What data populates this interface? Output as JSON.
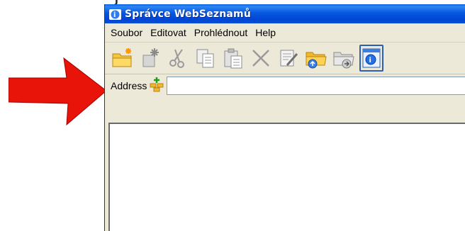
{
  "window": {
    "title": "Správce WebSeznamů",
    "accent_color": "#0a58dc",
    "title_icon": "app-globe-icon"
  },
  "menu": {
    "items": [
      {
        "label": "Soubor"
      },
      {
        "label": "Editovat"
      },
      {
        "label": "Prohlédnout"
      },
      {
        "label": "Help"
      }
    ]
  },
  "toolbar": {
    "buttons": [
      {
        "icon": "new-folder-icon"
      },
      {
        "icon": "new-item-icon"
      },
      {
        "icon": "cut-icon"
      },
      {
        "icon": "copy-icon"
      },
      {
        "icon": "paste-icon"
      },
      {
        "icon": "delete-icon"
      },
      {
        "icon": "properties-icon"
      },
      {
        "icon": "open-folder-icon"
      },
      {
        "icon": "export-folder-icon"
      },
      {
        "icon": "browser-window-icon"
      }
    ]
  },
  "address": {
    "label": "Address",
    "value": "",
    "icon": "add-network-icon"
  },
  "annotation": {
    "arrow_color": "#e8140a",
    "arrow_icon": "red-arrow-icon"
  }
}
